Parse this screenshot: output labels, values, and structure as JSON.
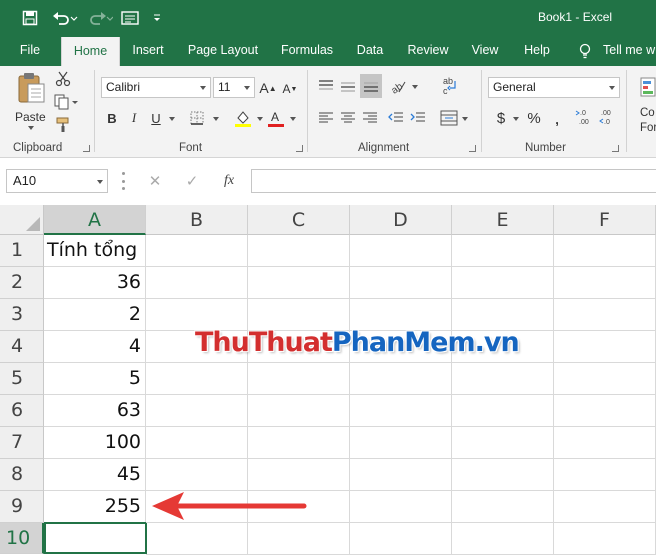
{
  "window": {
    "title": "Book1  -  Excel"
  },
  "tabs": [
    {
      "label": "File"
    },
    {
      "label": "Home"
    },
    {
      "label": "Insert"
    },
    {
      "label": "Page Layout"
    },
    {
      "label": "Formulas"
    },
    {
      "label": "Data"
    },
    {
      "label": "Review"
    },
    {
      "label": "View"
    },
    {
      "label": "Help"
    },
    {
      "label": "Tell me w"
    }
  ],
  "ribbon": {
    "clipboard": {
      "label": "Clipboard",
      "paste_label": "Paste"
    },
    "font": {
      "label": "Font",
      "font_name": "Calibri",
      "font_size": "11"
    },
    "alignment": {
      "label": "Alignment"
    },
    "number": {
      "label": "Number",
      "format": "General",
      "currency_symbol": "$",
      "percent_symbol": "%"
    },
    "styles": {
      "partial_line1": "Co",
      "partial_line2": "For"
    }
  },
  "formula_bar": {
    "name_box": "A10",
    "fx_label": "fx",
    "value": ""
  },
  "columns": [
    "A",
    "B",
    "C",
    "D",
    "E",
    "F"
  ],
  "rows": [
    "1",
    "2",
    "3",
    "4",
    "5",
    "6",
    "7",
    "8",
    "9",
    "10"
  ],
  "cells": {
    "A1": "Tính tổng",
    "A2": "36",
    "A3": "2",
    "A4": "4",
    "A5": "5",
    "A6": "63",
    "A7": "100",
    "A8": "45",
    "A9": "255",
    "A10": ""
  },
  "watermark": {
    "part1": "ThuThuat",
    "part2": "PhanMem",
    "part3": ".vn"
  },
  "colors": {
    "accent": "#217346",
    "arrow": "#e53935",
    "watermark_red": "#d32f2f",
    "watermark_blue": "#1565c0"
  }
}
